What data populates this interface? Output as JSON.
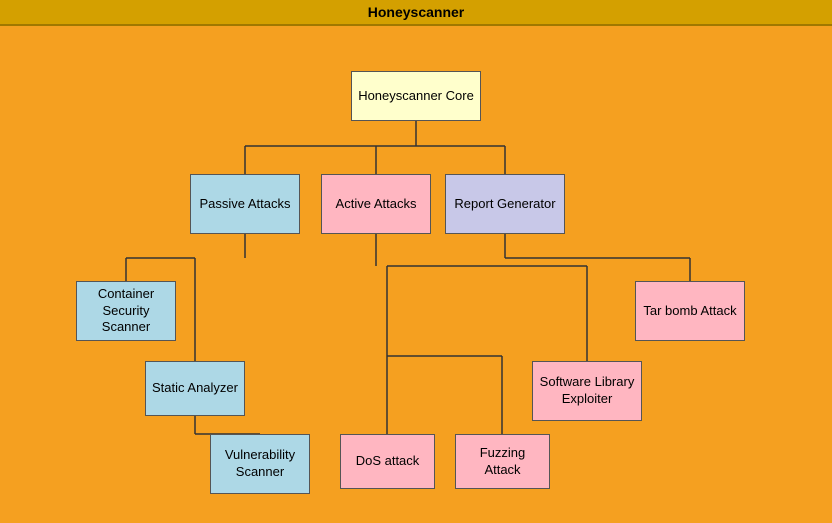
{
  "title": "Honeyscanner",
  "nodes": {
    "root": "Honeyscanner Core",
    "passive": "Passive Attacks",
    "active": "Active Attacks",
    "report": "Report Generator",
    "container": "Container Security Scanner",
    "static": "Static Analyzer",
    "vuln": "Vulnerability Scanner",
    "dos": "DoS attack",
    "fuzzing": "Fuzzing Attack",
    "software": "Software Library Exploiter",
    "tar": "Tar bomb Attack"
  }
}
